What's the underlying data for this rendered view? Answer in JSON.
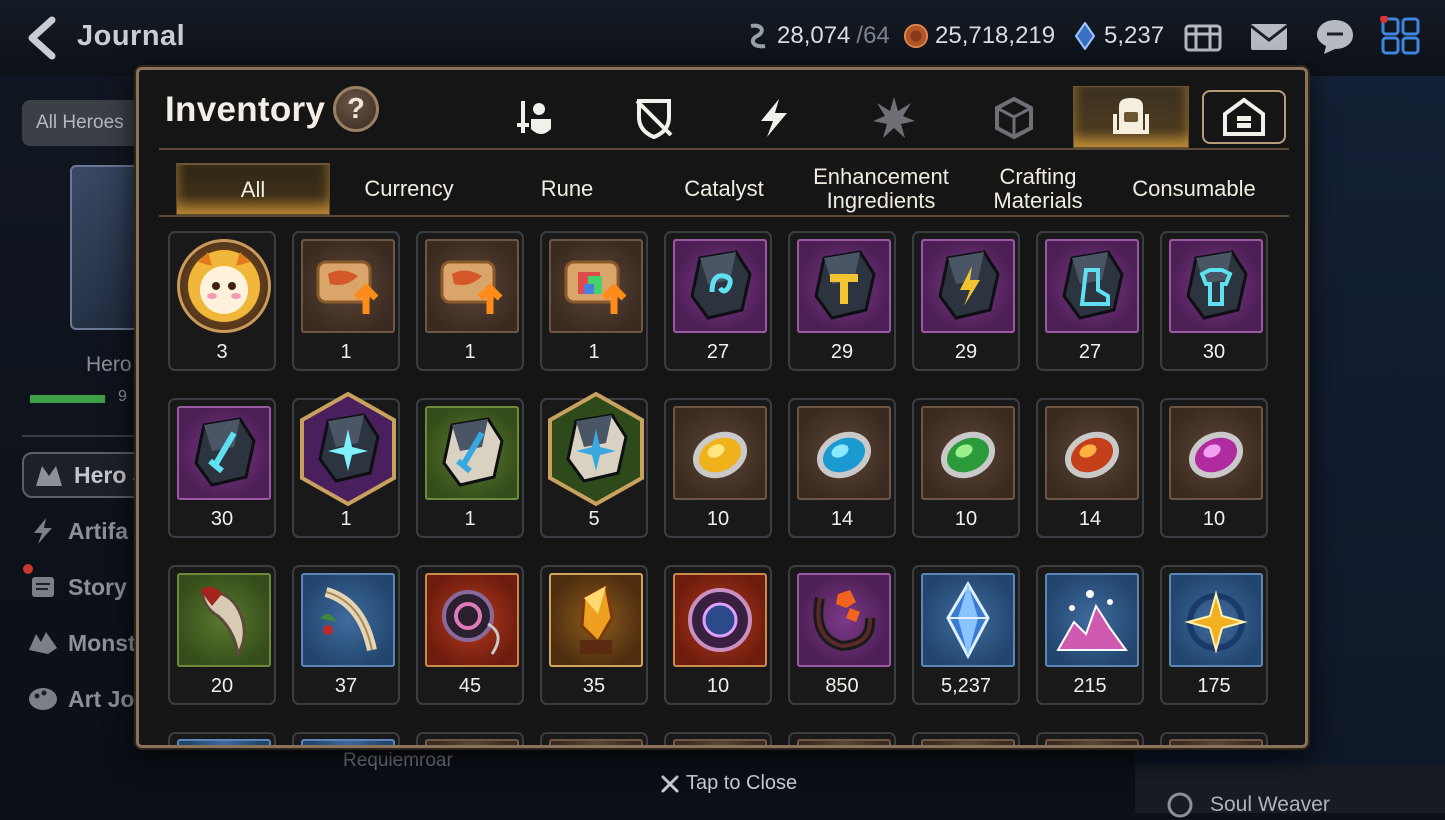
{
  "topbar": {
    "title": "Journal",
    "resources": [
      {
        "icon": "stamina-icon",
        "value": "28,074",
        "sub": "/64"
      },
      {
        "icon": "gold-coin-icon",
        "value": "25,718,219",
        "sub": ""
      },
      {
        "icon": "skystone-icon",
        "value": "5,237",
        "sub": ""
      }
    ],
    "icons": [
      "inventory-chest-icon",
      "mail-icon",
      "chat-icon",
      "menu-grid-icon"
    ]
  },
  "left_panel": {
    "filter_label": "All Heroes",
    "heroes_label": "Hero",
    "progress_text": "9",
    "menu": [
      {
        "label": "Hero J",
        "icon": "hero-journal-icon"
      },
      {
        "label": "Artifa",
        "icon": "lightning-icon"
      },
      {
        "label": "Story",
        "icon": "scroll-icon"
      },
      {
        "label": "Monst",
        "icon": "monster-icon"
      },
      {
        "label": "Art Jo",
        "icon": "palette-icon"
      }
    ]
  },
  "background": {
    "requiem_label": "Requiemroar",
    "soul_weaver_label": "Soul Weaver"
  },
  "tap_to_close": "Tap to Close",
  "modal": {
    "title": "Inventory",
    "help_label": "?",
    "category_tabs": [
      {
        "icon": "equipment-icon",
        "active": false
      },
      {
        "icon": "broken-shield-icon",
        "active": false
      },
      {
        "icon": "lightning-icon",
        "active": false
      },
      {
        "icon": "burst-icon",
        "active": false
      },
      {
        "icon": "cube-icon",
        "active": false
      },
      {
        "icon": "backpack-icon",
        "active": true
      },
      {
        "icon": "storage-house-icon",
        "active": false
      }
    ],
    "sub_tabs": [
      {
        "label": "All",
        "active": true
      },
      {
        "label": "Currency",
        "active": false
      },
      {
        "label": "Rune",
        "active": false
      },
      {
        "label": "Catalyst",
        "active": false
      },
      {
        "label": "Enhancement\nIngredients",
        "active": false
      },
      {
        "label": "Crafting\nMaterials",
        "active": false
      },
      {
        "label": "Consumable",
        "active": false
      }
    ],
    "items": [
      {
        "icon": "phantasma-mascot-icon",
        "frame": "circle",
        "count": "3"
      },
      {
        "icon": "scroll-upgrade-icon",
        "frame": "brown",
        "count": "1"
      },
      {
        "icon": "scroll-upgrade-icon",
        "frame": "brown",
        "count": "1"
      },
      {
        "icon": "scroll-rainbow-icon",
        "frame": "brown",
        "count": "1"
      },
      {
        "icon": "rune-stone-spiral-icon",
        "frame": "purple",
        "count": "27"
      },
      {
        "icon": "rune-stone-hammer-icon",
        "frame": "purple",
        "count": "29"
      },
      {
        "icon": "rune-stone-bolt-icon",
        "frame": "purple",
        "count": "29"
      },
      {
        "icon": "rune-stone-boot-icon",
        "frame": "purple",
        "count": "27"
      },
      {
        "icon": "rune-stone-armor-icon",
        "frame": "purple",
        "count": "30"
      },
      {
        "icon": "rune-stone-sword-icon",
        "frame": "purple",
        "count": "30"
      },
      {
        "icon": "rune-stone-star-icon",
        "frame": "hex-purple",
        "count": "1"
      },
      {
        "icon": "rune-stone-sword-pale-icon",
        "frame": "green",
        "count": "1"
      },
      {
        "icon": "rune-stone-star-pale-icon",
        "frame": "hex-green",
        "count": "5"
      },
      {
        "icon": "catalyst-yellow-icon",
        "frame": "brown",
        "count": "10"
      },
      {
        "icon": "catalyst-ice-icon",
        "frame": "brown",
        "count": "14"
      },
      {
        "icon": "catalyst-green-icon",
        "frame": "brown",
        "count": "10"
      },
      {
        "icon": "catalyst-red-icon",
        "frame": "brown",
        "count": "14"
      },
      {
        "icon": "catalyst-pink-icon",
        "frame": "brown",
        "count": "10"
      },
      {
        "icon": "claw-icon",
        "frame": "green",
        "count": "20"
      },
      {
        "icon": "feather-branch-icon",
        "frame": "blue",
        "count": "37"
      },
      {
        "icon": "amulet-icon",
        "frame": "red",
        "count": "45"
      },
      {
        "icon": "crystal-shard-icon",
        "frame": "gold",
        "count": "35"
      },
      {
        "icon": "rune-disk-icon",
        "frame": "red",
        "count": "10"
      },
      {
        "icon": "horseshoe-icon",
        "frame": "purple",
        "count": "850"
      },
      {
        "icon": "skystone-crystal-icon",
        "frame": "blue",
        "count": "5,237"
      },
      {
        "icon": "pink-crystal-icon",
        "frame": "blue",
        "count": "215"
      },
      {
        "icon": "star-compass-icon",
        "frame": "blue",
        "count": "175"
      }
    ],
    "partial_row_frames": [
      "blue",
      "blue",
      "brown",
      "brown",
      "brown",
      "brown",
      "brown",
      "brown",
      "brown"
    ]
  },
  "colors": {
    "gold_accent": "#d9a441",
    "panel_border": "#8a735a",
    "text_light": "#f2f0ea"
  }
}
